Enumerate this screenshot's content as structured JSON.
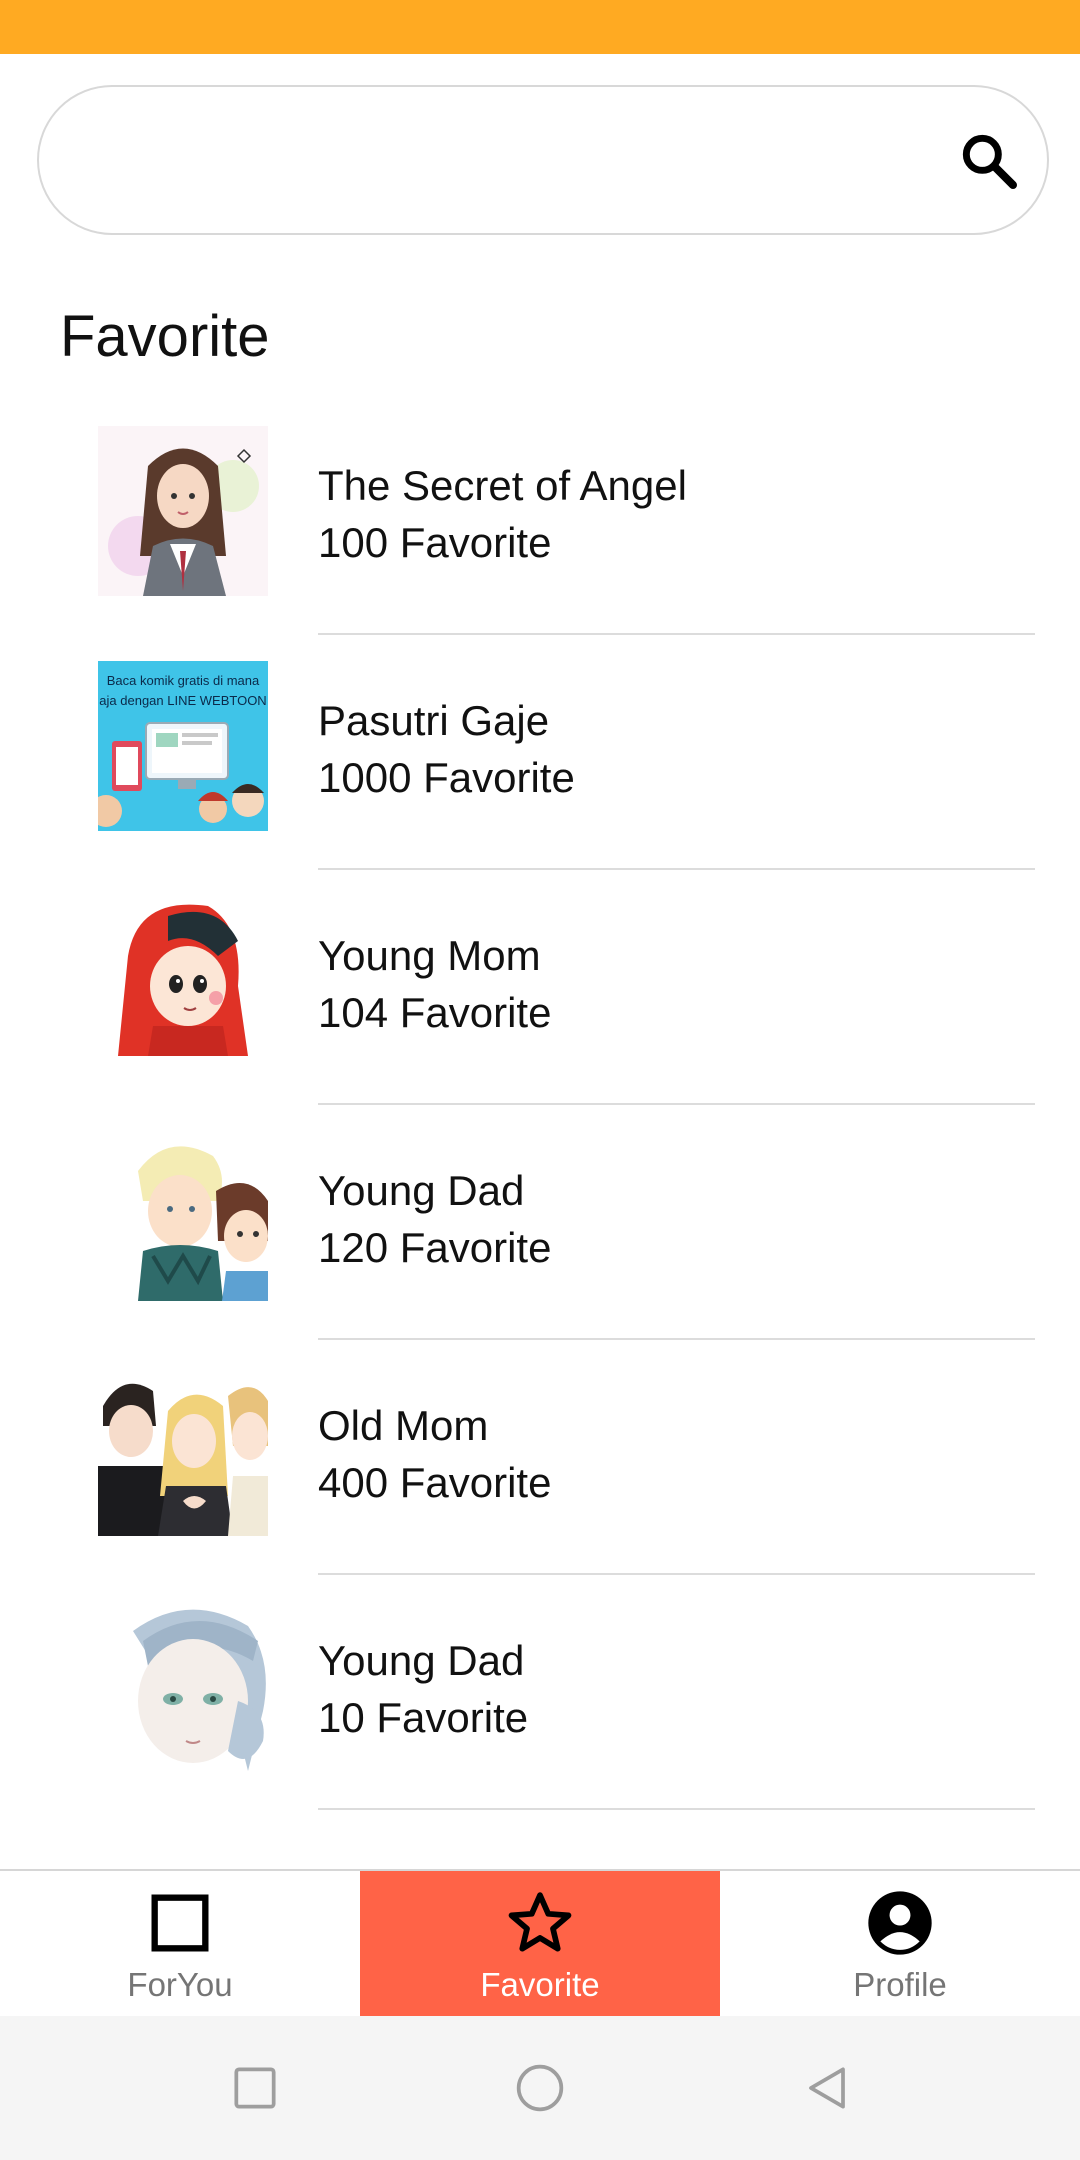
{
  "theme": {
    "status_bar_color": "#FFAA22",
    "active_tab_color": "#FF6347"
  },
  "search": {
    "placeholder": "",
    "value": "",
    "icon": "search-icon"
  },
  "page_title": "Favorite",
  "favorites": [
    {
      "title": "The Secret of Angel",
      "count": "100 Favorite",
      "thumbnail": "girl-with-long-hair-illustration"
    },
    {
      "title": "Pasutri Gaje",
      "count": "1000 Favorite",
      "thumbnail": "webtoon-promo-banner",
      "thumbnail_text_1": "Baca komik gratis di mana",
      "thumbnail_text_2": "aja dengan LINE WEBTOON"
    },
    {
      "title": "Young Mom",
      "count": "104 Favorite",
      "thumbnail": "red-hooded-kid-illustration"
    },
    {
      "title": "Young Dad",
      "count": "120 Favorite",
      "thumbnail": "blonde-boy-with-child-illustration"
    },
    {
      "title": "Old Mom",
      "count": "400 Favorite",
      "thumbnail": "group-of-characters-illustration"
    },
    {
      "title": "Young Dad",
      "count": "10 Favorite",
      "thumbnail": "pale-boy-face-illustration"
    }
  ],
  "bottom_nav": {
    "tabs": [
      {
        "label": "ForYou",
        "icon": "square-icon",
        "active": false
      },
      {
        "label": "Favorite",
        "icon": "star-icon",
        "active": true
      },
      {
        "label": "Profile",
        "icon": "account-circle-icon",
        "active": false
      }
    ]
  },
  "system_nav": {
    "buttons": [
      "recents-square-icon",
      "home-circle-icon",
      "back-triangle-icon"
    ]
  }
}
